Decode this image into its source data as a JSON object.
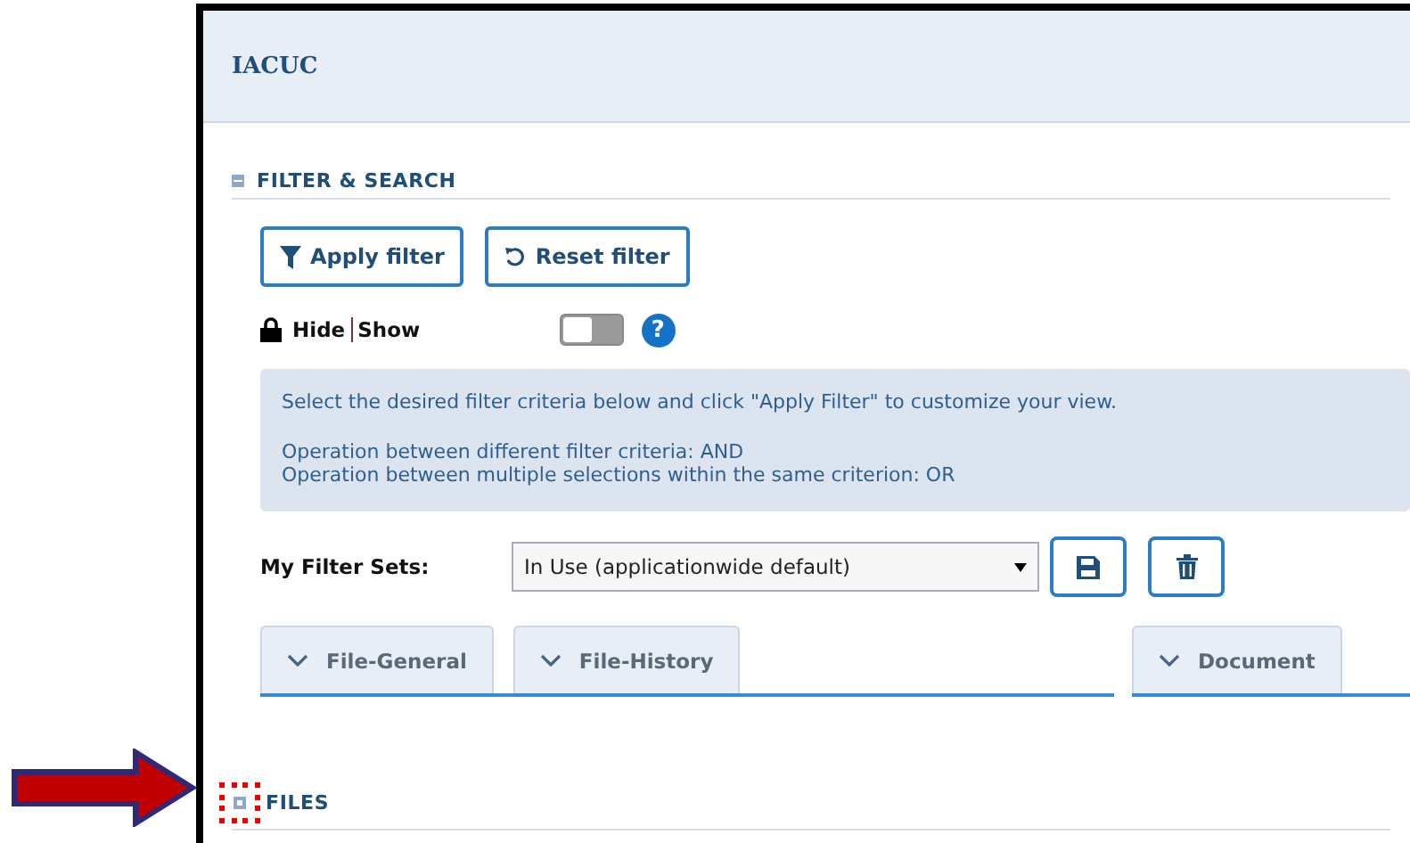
{
  "header": {
    "title": "IACUC"
  },
  "filter_section": {
    "title": "FILTER & SEARCH",
    "expanded": true
  },
  "buttons": [
    {
      "label": "Apply filter",
      "kind": "filter"
    },
    {
      "label": "Reset filter",
      "kind": "reset"
    }
  ],
  "visibility": {
    "hide_label": "Hide",
    "show_label": "Show",
    "toggle_on": false
  },
  "help": {
    "glyph": "?"
  },
  "info": {
    "paragraphs": [
      [
        "Select the desired filter criteria below and click \"Apply Filter\" to customize your view."
      ],
      [
        "Operation between different filter criteria: AND",
        "Operation between multiple selections within the same criterion: OR"
      ]
    ]
  },
  "filter_sets": {
    "label": "My Filter Sets:",
    "value": "In Use (applicationwide default)"
  },
  "tab_groups": [
    [
      {
        "label": "File-General",
        "expanded": false
      },
      {
        "label": "File-History",
        "expanded": false
      }
    ],
    [
      {
        "label": "Document",
        "expanded": false
      }
    ]
  ],
  "files_section": {
    "title": "FILES",
    "expanded": false
  }
}
